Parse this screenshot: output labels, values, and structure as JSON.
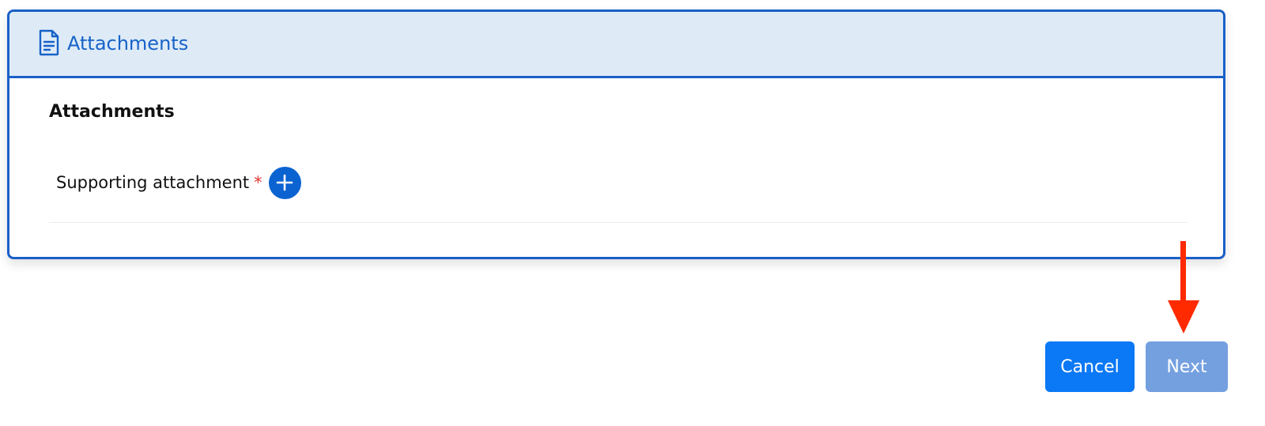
{
  "panel": {
    "header_title": "Attachments",
    "header_icon": "document-icon",
    "section_title": "Attachments",
    "field": {
      "label": "Supporting attachment",
      "required_marker": "*",
      "add_icon": "plus-icon"
    }
  },
  "actions": {
    "cancel_label": "Cancel",
    "next_label": "Next"
  },
  "annotation": {
    "icon": "arrow-down-icon",
    "color": "#ff2a00"
  },
  "colors": {
    "accent": "#1a5fc7",
    "header_bg": "#deebf7",
    "cancel_bg": "#0b78f5",
    "next_bg_disabled": "#74a0e0",
    "required": "#e53935"
  }
}
